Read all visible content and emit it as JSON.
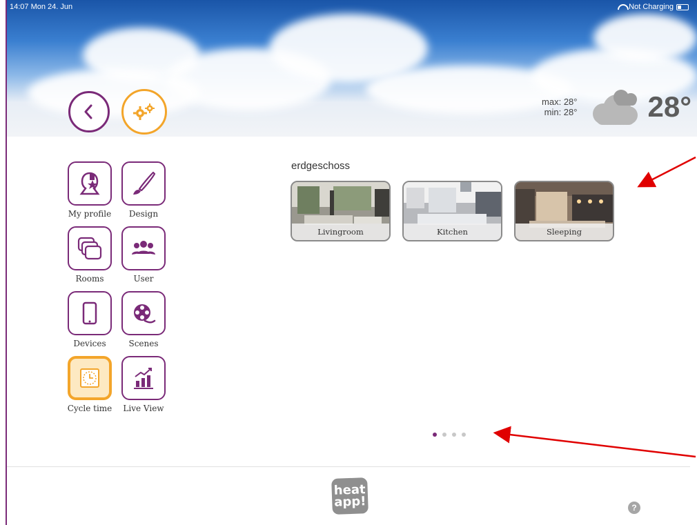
{
  "statusbar": {
    "time": "14:07  Mon 24. Jun",
    "charging": "Not Charging"
  },
  "header": {
    "back_icon": "chevron-left-icon",
    "settings_icon": "gears-icon"
  },
  "weather": {
    "max": "max: 28°",
    "min": "min: 28°",
    "temp": "28°",
    "icon": "cloudy-icon"
  },
  "menu": [
    {
      "label": "My profile",
      "icon": "profile-star-icon",
      "active": false
    },
    {
      "label": "Design",
      "icon": "brush-icon",
      "active": false
    },
    {
      "label": "Rooms",
      "icon": "rooms-stack-icon",
      "active": false
    },
    {
      "label": "User",
      "icon": "users-icon",
      "active": false
    },
    {
      "label": "Devices",
      "icon": "tablet-icon",
      "active": false
    },
    {
      "label": "Scenes",
      "icon": "film-reel-icon",
      "active": false
    },
    {
      "label": "Cycle time",
      "icon": "clock-icon",
      "active": true
    },
    {
      "label": "Live View",
      "icon": "bar-chart-icon",
      "active": false
    }
  ],
  "main": {
    "section_title": "erdgeschoss",
    "rooms": [
      {
        "label": "Livingroom"
      },
      {
        "label": "Kitchen"
      },
      {
        "label": "Sleeping"
      }
    ],
    "pagination": {
      "pages": 4,
      "current": 1
    }
  },
  "footer": {
    "logo_text_top": "heat",
    "logo_text_bottom": "app!",
    "help_label": "?"
  },
  "colors": {
    "brand_purple": "#7a2a78",
    "brand_orange": "#f3a52a",
    "annotation_red": "#e00000"
  }
}
